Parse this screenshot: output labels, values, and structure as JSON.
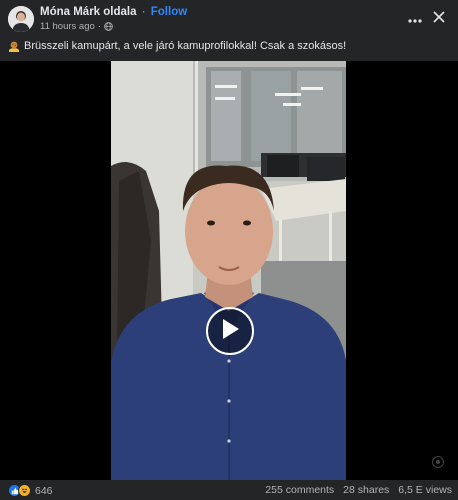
{
  "post": {
    "author": "Móna Márk oldala",
    "separator": "·",
    "follow_label": "Follow",
    "timestamp": "11 hours ago",
    "meta_separator": "·",
    "caption": "Brüsszeli kamupárt, a vele járó kamuprofilokkal! Csak a szokásos!"
  },
  "footer": {
    "reaction_count": "646",
    "comments": "255 comments",
    "shares": "28 shares",
    "views": "6,5 E views"
  },
  "colors": {
    "background": "#242526",
    "text": "#e4e6eb",
    "secondary_text": "#b0b3b8",
    "follow_blue": "#2d88ff",
    "like_blue": "#1877f2",
    "haha_yellow": "#f7b125"
  },
  "icons": {
    "more": "more-icon",
    "close": "close-icon",
    "globe": "globe-icon",
    "play": "play-icon",
    "caption_emoji": "cookie-hand-emoji",
    "like": "like-icon",
    "haha": "haha-icon"
  }
}
